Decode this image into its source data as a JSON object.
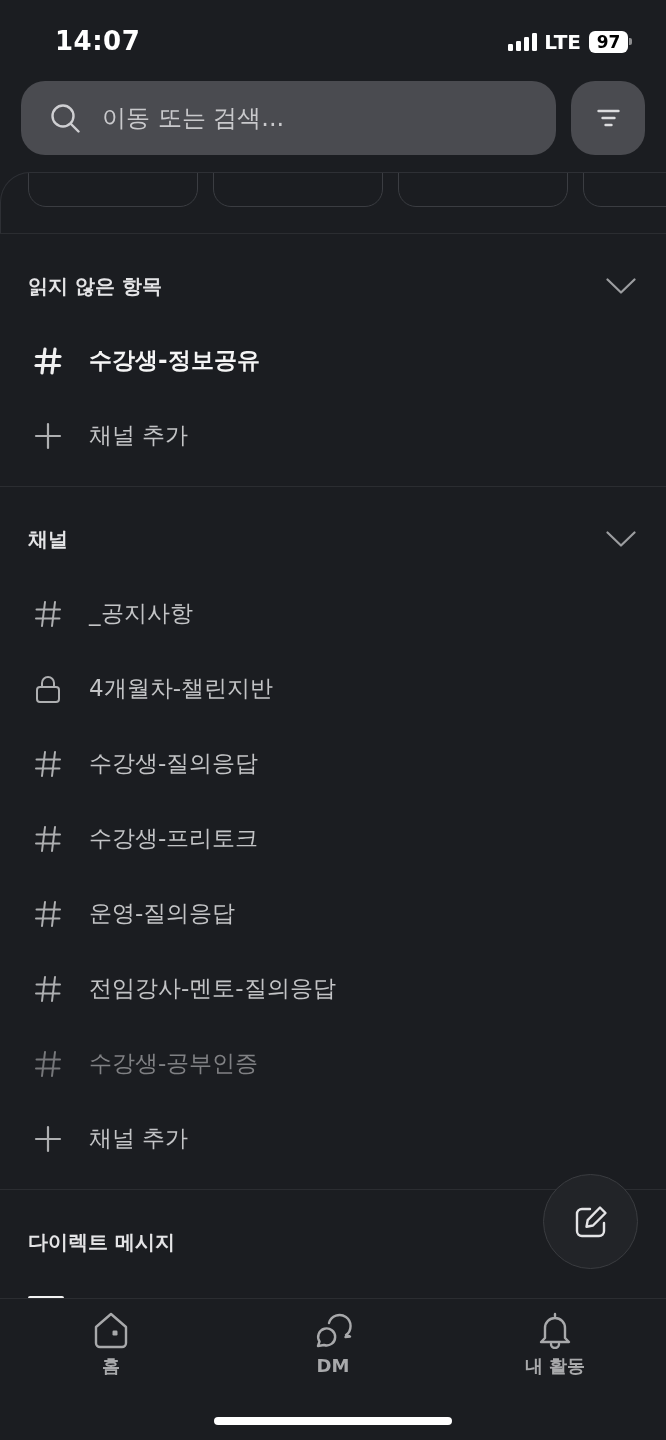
{
  "status_bar": {
    "time": "14:07",
    "network": "LTE",
    "battery": "97"
  },
  "search": {
    "placeholder": "이동 또는 검색..."
  },
  "sections": [
    {
      "title": "읽지 않은 항목",
      "expanded": true,
      "items": [
        {
          "kind": "public",
          "name": "수강생-정보공유",
          "unread": true,
          "muted": false
        }
      ],
      "add_label": "채널 추가"
    },
    {
      "title": "채널",
      "expanded": true,
      "items": [
        {
          "kind": "public",
          "name": "_공지사항",
          "unread": false,
          "muted": false
        },
        {
          "kind": "private",
          "name": "4개월차-챌린지반",
          "unread": false,
          "muted": false
        },
        {
          "kind": "public",
          "name": "수강생-질의응답",
          "unread": false,
          "muted": false
        },
        {
          "kind": "public",
          "name": "수강생-프리토크",
          "unread": false,
          "muted": false
        },
        {
          "kind": "public",
          "name": "운영-질의응답",
          "unread": false,
          "muted": false
        },
        {
          "kind": "public",
          "name": "전임강사-멘토-질의응답",
          "unread": false,
          "muted": false
        },
        {
          "kind": "public",
          "name": "수강생-공부인증",
          "unread": false,
          "muted": true
        }
      ],
      "add_label": "채널 추가"
    },
    {
      "title": "다이렉트 메시지"
    }
  ],
  "tab_bar": [
    {
      "kind": "home",
      "label": "홈"
    },
    {
      "kind": "dm",
      "label": "DM"
    },
    {
      "kind": "activity",
      "label": "내 활동"
    }
  ]
}
